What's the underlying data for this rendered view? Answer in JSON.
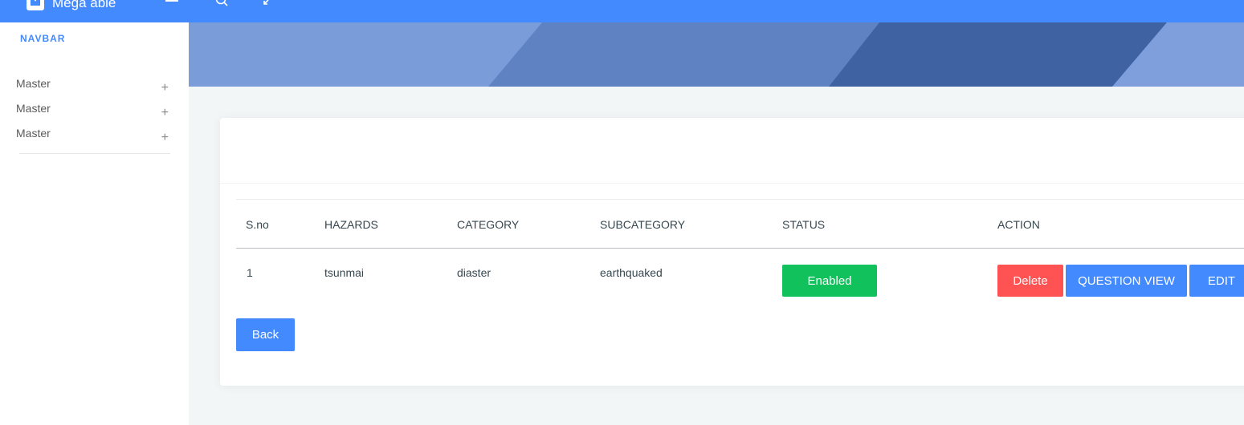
{
  "app": {
    "title": "Mega able"
  },
  "sidebar": {
    "heading": "NAVBAR",
    "items": [
      {
        "label": "Master",
        "toggle": "+"
      },
      {
        "label": "Master",
        "toggle": "+"
      },
      {
        "label": "Master",
        "toggle": "+"
      }
    ]
  },
  "table": {
    "headers": [
      "S.no",
      "HAZARDS",
      "CATEGORY",
      "SUBCATEGORY",
      "STATUS",
      "ACTION"
    ],
    "rows": [
      {
        "sno": "1",
        "hazard": "tsunmai",
        "category": "diaster",
        "subcategory": "earthquaked",
        "status": "Enabled",
        "actions": {
          "delete": "Delete",
          "question_view": "QUESTION VIEW",
          "edit": "EDIT"
        }
      }
    ]
  },
  "buttons": {
    "back": "Back"
  },
  "colors": {
    "primary": "#448aff",
    "success": "#11c15b",
    "danger": "#ff5252",
    "banner": "#7c9fd9"
  }
}
